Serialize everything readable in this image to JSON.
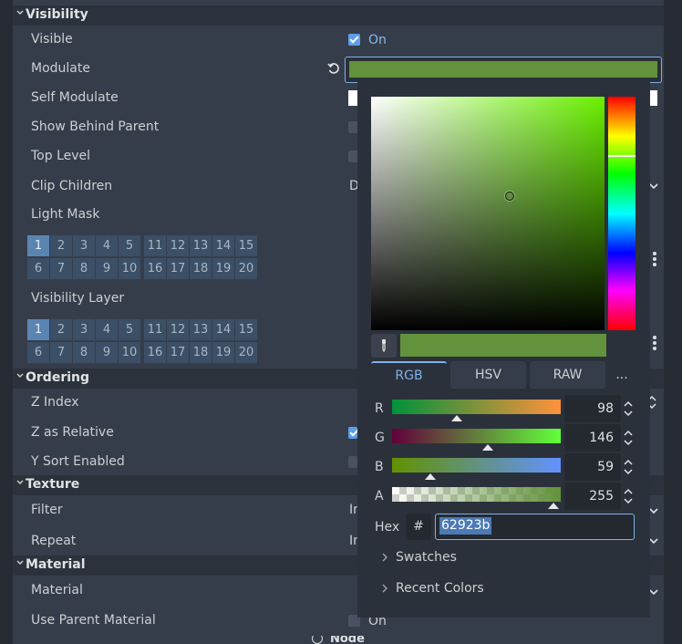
{
  "sections": {
    "visibility": "Visibility",
    "ordering": "Ordering",
    "texture": "Texture",
    "material": "Material"
  },
  "bottom_tab": "Node",
  "properties": {
    "visible": {
      "label": "Visible",
      "value": "On",
      "checked": true
    },
    "modulate": {
      "label": "Modulate"
    },
    "self_modulate": {
      "label": "Self Modulate"
    },
    "show_behind_parent": {
      "label": "Show Behind Parent"
    },
    "top_level": {
      "label": "Top Level"
    },
    "clip_children": {
      "label": "Clip Children",
      "value_partial": "D"
    },
    "light_mask": {
      "label": "Light Mask"
    },
    "visibility_layer": {
      "label": "Visibility Layer"
    },
    "z_index": {
      "label": "Z Index"
    },
    "z_as_relative": {
      "label": "Z as Relative"
    },
    "y_sort_enabled": {
      "label": "Y Sort Enabled"
    },
    "filter": {
      "label": "Filter",
      "value_partial": "In"
    },
    "repeat": {
      "label": "Repeat",
      "value_partial": "In"
    },
    "material": {
      "label": "Material"
    },
    "use_parent_material": {
      "label": "Use Parent Material",
      "value": "On",
      "checked": false
    }
  },
  "layers": [
    "1",
    "2",
    "3",
    "4",
    "5",
    "6",
    "7",
    "8",
    "9",
    "10",
    "11",
    "12",
    "13",
    "14",
    "15",
    "16",
    "17",
    "18",
    "19",
    "20"
  ],
  "color_picker": {
    "modes": [
      "RGB",
      "HSV",
      "RAW",
      "..."
    ],
    "active_mode": "RGB",
    "channels": [
      {
        "label": "R",
        "value": "98"
      },
      {
        "label": "G",
        "value": "146"
      },
      {
        "label": "B",
        "value": "59"
      },
      {
        "label": "A",
        "value": "255"
      }
    ],
    "hex_label": "Hex",
    "hash": "#",
    "hex_value": "62923b",
    "swatches_label": "Swatches",
    "recent_label": "Recent Colors"
  },
  "colors": {
    "current": "#62923b",
    "accent": "#7fb0ea"
  }
}
